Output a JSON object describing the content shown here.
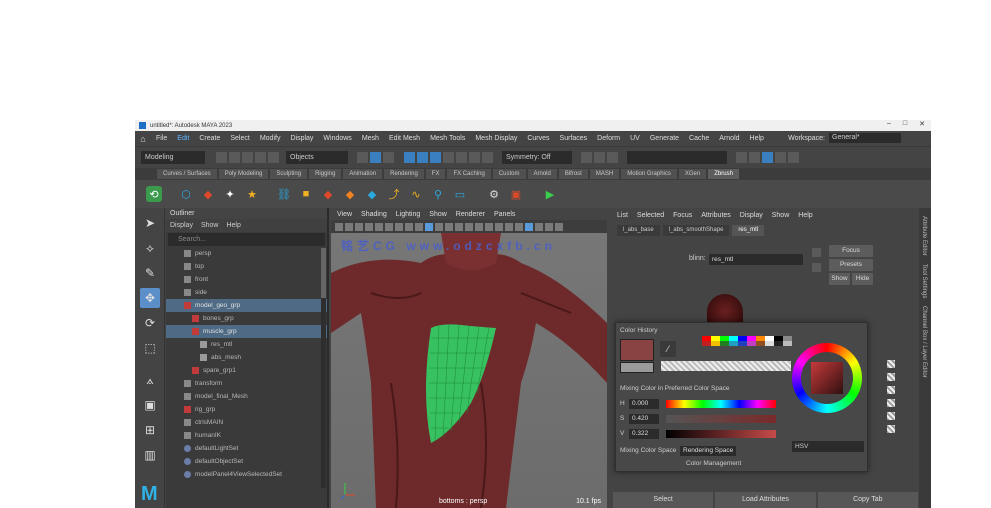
{
  "window": {
    "title": "untitled*: Autodesk MAYA 2023",
    "controls": [
      "–",
      "□",
      "✕"
    ]
  },
  "menubar": {
    "items": [
      "File",
      "Edit",
      "Create",
      "Select",
      "Modify",
      "Display",
      "Windows",
      "Mesh",
      "Edit Mesh",
      "Mesh Tools",
      "Mesh Display",
      "Curves",
      "Surfaces",
      "Deform",
      "UV",
      "Generate",
      "Cache",
      "Arnold",
      "Help"
    ],
    "active_index": 1,
    "workspace_label": "Workspace:",
    "workspace_value": "General*"
  },
  "statusline": {
    "mode": "Modeling",
    "object_mode": "Objects",
    "symmetry": "Symmetry: Off"
  },
  "shelf_tabs": {
    "items": [
      "Curves / Surfaces",
      "Poly Modeling",
      "Sculpting",
      "Rigging",
      "Animation",
      "Rendering",
      "FX",
      "FX Caching",
      "Custom",
      "Arnold",
      "Bifrost",
      "MASH",
      "Motion Graphics",
      "XGen",
      "Zbrush"
    ],
    "active_index": 14
  },
  "outliner": {
    "title": "Outliner",
    "menu": [
      "Display",
      "Show",
      "Help"
    ],
    "search": "Search...",
    "rows": [
      {
        "label": "persp",
        "indent": 0,
        "icon": "camera-icon",
        "sel": false
      },
      {
        "label": "top",
        "indent": 0,
        "icon": "camera-icon",
        "sel": false
      },
      {
        "label": "front",
        "indent": 0,
        "icon": "camera-icon",
        "sel": false
      },
      {
        "label": "side",
        "indent": 0,
        "icon": "camera-icon",
        "sel": false
      },
      {
        "label": "model_geo_grp",
        "indent": 0,
        "icon": "group-icon",
        "sel": true
      },
      {
        "label": "bones_grp",
        "indent": 1,
        "icon": "group-icon",
        "sel": false
      },
      {
        "label": "muscle_grp",
        "indent": 1,
        "icon": "group-icon",
        "sel": true
      },
      {
        "label": "res_mtl",
        "indent": 2,
        "icon": "mesh-icon",
        "sel": false
      },
      {
        "label": "abs_mesh",
        "indent": 2,
        "icon": "mesh-icon",
        "sel": false
      },
      {
        "label": "spare_grp1",
        "indent": 1,
        "icon": "group-icon",
        "sel": false
      },
      {
        "label": "transform",
        "indent": 0,
        "icon": "transform-icon",
        "sel": false
      },
      {
        "label": "model_final_Mesh",
        "indent": 0,
        "icon": "transform-icon",
        "sel": false
      },
      {
        "label": "rig_grp",
        "indent": 0,
        "icon": "group-icon",
        "sel": false
      },
      {
        "label": "ctrlsMAIN",
        "indent": 0,
        "icon": "transform-icon",
        "sel": false
      },
      {
        "label": "humanIK",
        "indent": 0,
        "icon": "transform-icon",
        "sel": false
      },
      {
        "label": "defaultLightSet",
        "indent": 0,
        "icon": "set-icon",
        "sel": false
      },
      {
        "label": "defaultObjectSet",
        "indent": 0,
        "icon": "set-icon",
        "sel": false
      },
      {
        "label": "modelPanel4ViewSelectedSet",
        "indent": 0,
        "icon": "set-icon",
        "sel": false
      }
    ]
  },
  "viewport": {
    "menu": [
      "View",
      "Shading",
      "Lighting",
      "Show",
      "Renderer",
      "Panels"
    ],
    "watermark": "铭艺CG  www.odzcxfb.cn",
    "camera_label": "bottoms : persp",
    "fps": "10.1 fps"
  },
  "attribute_editor": {
    "menu": [
      "List",
      "Selected",
      "Focus",
      "Attributes",
      "Display",
      "Show",
      "Help"
    ],
    "tabs": [
      "l_abs_base",
      "l_abs_smoothShape",
      "res_mtl"
    ],
    "active_tab": 2,
    "name_label": "blinn:",
    "name_value": "res_mtl",
    "buttons": [
      "Focus",
      "Presets",
      "Show",
      "Hide"
    ],
    "side_tabs": [
      "Attribute Editor",
      "Tool Settings",
      "Channel Box / Layer Editor"
    ],
    "bottom_buttons": [
      "Select",
      "Load Attributes",
      "Copy Tab"
    ]
  },
  "color_history": {
    "title": "Color History",
    "mixing_title": "Mixing Color in Preferred Color Space",
    "channels": [
      {
        "label": "H",
        "value": "0.000"
      },
      {
        "label": "S",
        "value": "0.420"
      },
      {
        "label": "V",
        "value": "0.322"
      }
    ],
    "mixing_space_label": "Mixing Color Space",
    "mixing_space_value": "Rendering Space",
    "color_management": "Color Management",
    "mode": "HSV",
    "current_color": "#8a4343",
    "swatches": [
      "#ff0000",
      "#ffff00",
      "#00ff00",
      "#00ffff",
      "#0000ff",
      "#ff00ff",
      "#ff8800",
      "#ffffff",
      "#000000",
      "#888888",
      "#c02020",
      "#f0c000",
      "#208020",
      "#20a0c0",
      "#2040c0",
      "#c040c0",
      "#905020",
      "#dddddd",
      "#222222",
      "#bbbbbb"
    ]
  }
}
